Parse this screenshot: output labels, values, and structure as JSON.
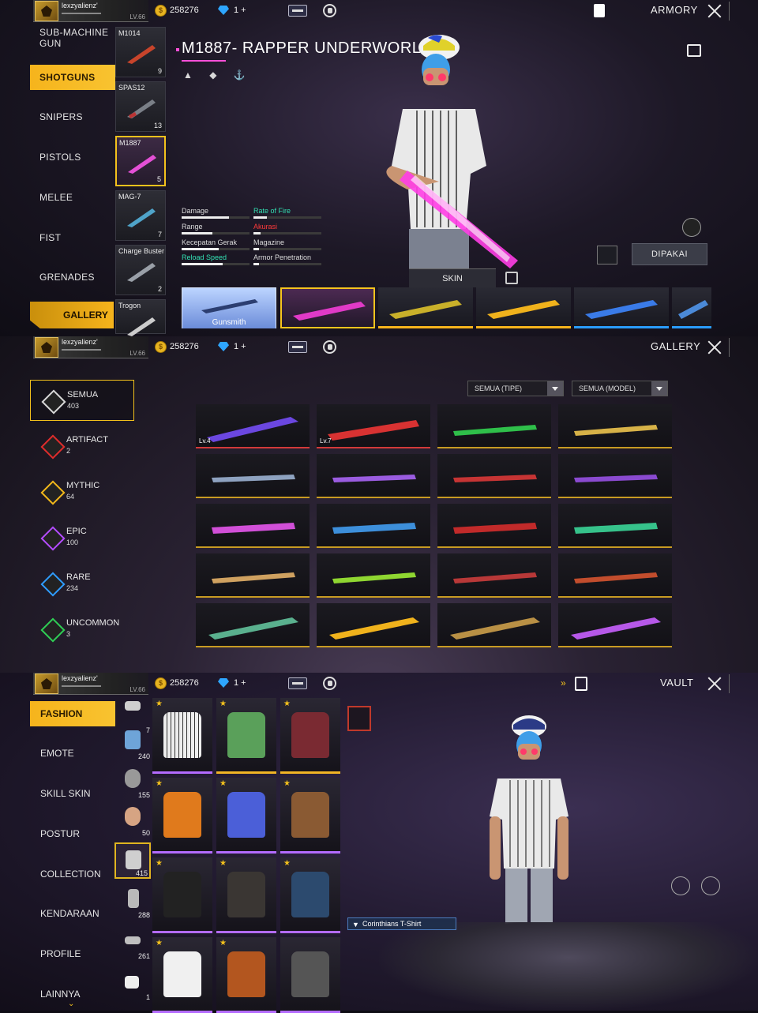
{
  "profile": {
    "name": "lexzyalienz'",
    "level": "LV.66",
    "coins": "258276",
    "diamonds": "1 +"
  },
  "armory": {
    "title": "ARMORY",
    "categories": [
      "SUB-MACHINE GUN",
      "SHOTGUNS",
      "SNIPERS",
      "PISTOLS",
      "MELEE",
      "FIST",
      "GRENADES"
    ],
    "gallery_label": "GALLERY",
    "weapons": [
      {
        "name": "M1014",
        "count": "9"
      },
      {
        "name": "SPAS12",
        "count": "13"
      },
      {
        "name": "M1887",
        "count": "5"
      },
      {
        "name": "MAG-7",
        "count": "7"
      },
      {
        "name": "Charge Buster",
        "count": "2"
      },
      {
        "name": "Trogon",
        "count": ""
      }
    ],
    "weapon_title": "M1887- RAPPER UNDERWORLD",
    "stats_left": [
      "Damage",
      "Range",
      "Kecepatan Gerak",
      "Reload Speed"
    ],
    "stats_right": [
      "Rate of Fire",
      "Akurasi",
      "Magazine",
      "Armor Penetration"
    ],
    "equipped_label": "DIPAKAI",
    "skin_tab": "SKIN",
    "gunsmith_label": "Gunsmith"
  },
  "gallery": {
    "title": "GALLERY",
    "rarities": [
      {
        "name": "SEMUA",
        "count": "403",
        "color": "#d8d8d8"
      },
      {
        "name": "ARTIFACT",
        "count": "2",
        "color": "#e02c2c"
      },
      {
        "name": "MYTHIC",
        "count": "64",
        "color": "#f2b71b"
      },
      {
        "name": "EPIC",
        "count": "100",
        "color": "#b44cff"
      },
      {
        "name": "RARE",
        "count": "234",
        "color": "#2f9cff"
      },
      {
        "name": "UNCOMMON",
        "count": "3",
        "color": "#2fcf55"
      }
    ],
    "filter_type": "SEMUA (TIPE)",
    "filter_model": "SEMUA (MODEL)",
    "level_badges": [
      "Lv.4",
      "Lv.7"
    ]
  },
  "vault": {
    "title": "VAULT",
    "categories": [
      "FASHION",
      "EMOTE",
      "SKILL SKIN",
      "POSTUR",
      "COLLECTION",
      "KENDARAAN",
      "PROFILE",
      "LAINNYA"
    ],
    "slot_counts": [
      "7",
      "240",
      "155",
      "50",
      "415",
      "288",
      "261",
      "1"
    ],
    "equipped_item": "Corinthians T-Shirt"
  }
}
